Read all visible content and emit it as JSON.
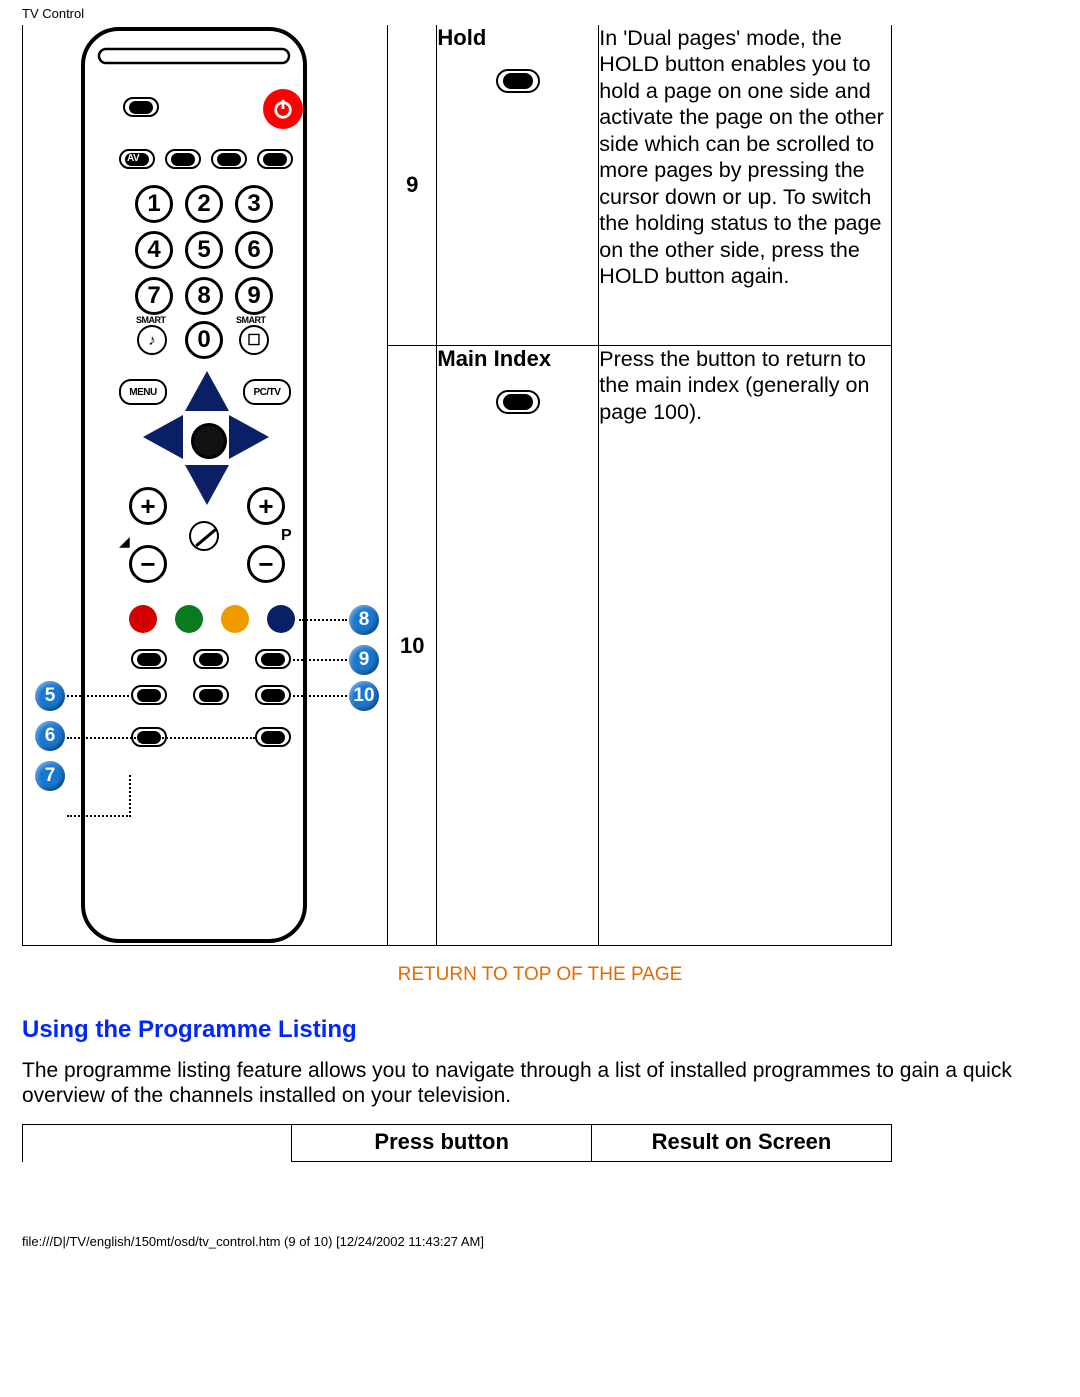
{
  "page": {
    "title": "TV Control",
    "footer": "file:///D|/TV/english/150mt/osd/tv_control.htm (9 of 10) [12/24/2002 11:43:27 AM]"
  },
  "remote": {
    "digits": [
      "1",
      "2",
      "3",
      "4",
      "5",
      "6",
      "7",
      "8",
      "9",
      "0"
    ],
    "smart_left_label": "SMART",
    "smart_right_label": "SMART",
    "smart_left_glyph": "♪",
    "smart_right_glyph": "☐",
    "menu_label": "MENU",
    "pctv_label": "PC/TV",
    "volume_ramp_label": "◢",
    "programme_label": "P",
    "callouts_left": [
      "5",
      "6",
      "7"
    ],
    "callouts_right": [
      "8",
      "9",
      "10"
    ],
    "color_dots": [
      "#d40000",
      "#0a7a1f",
      "#ef9b00",
      "#0b1f66"
    ]
  },
  "rows": [
    {
      "num": "9",
      "label": "Hold",
      "desc": "In 'Dual pages' mode, the HOLD button enables you to hold a page on one side and activate the page on the other side which can be scrolled to more pages by pressing the cursor down or up. To switch the holding status to the page on the other side, press the HOLD button again."
    },
    {
      "num": "10",
      "label": "Main Index",
      "desc": "Press the button to return to the main index (generally on page 100)."
    }
  ],
  "return_link": "RETURN TO TOP OF THE PAGE",
  "section": {
    "heading": "Using the Programme Listing",
    "para": "The programme listing feature allows you to navigate through a list of installed programmes to gain a quick overview of the channels installed on your television."
  },
  "listing_table": {
    "press": "Press button",
    "result": "Result on Screen"
  }
}
